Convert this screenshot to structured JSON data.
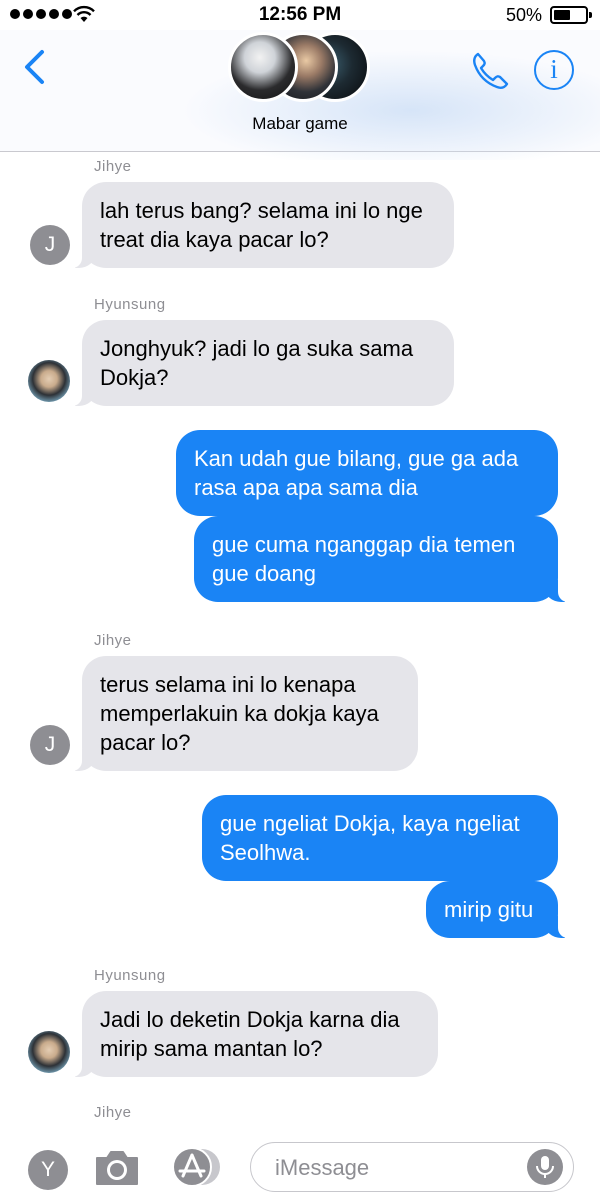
{
  "status_bar": {
    "time": "12:56 PM",
    "battery_percent": "50%",
    "signal_dots": 5
  },
  "header": {
    "title": "Mabar game",
    "back_icon": "chevron-left-icon",
    "call_icon": "phone-icon",
    "info_label": "i"
  },
  "messages": [
    {
      "type": "sender",
      "text": "Jihye"
    },
    {
      "type": "in",
      "text": "lah terus bang? selama ini lo nge treat dia kaya pacar lo?",
      "avatar": "J"
    },
    {
      "type": "sender",
      "text": "Hyunsung"
    },
    {
      "type": "in",
      "text": "Jonghyuk? jadi lo ga suka sama Dokja?",
      "avatar": "photo"
    },
    {
      "type": "out",
      "text": "Kan udah gue bilang, gue ga ada rasa apa apa sama dia"
    },
    {
      "type": "out",
      "text": "gue cuma nganggap dia temen gue doang"
    },
    {
      "type": "sender",
      "text": "Jihye"
    },
    {
      "type": "in",
      "text": "terus selama ini lo kenapa memperlakuin ka dokja kaya pacar lo?",
      "avatar": "J"
    },
    {
      "type": "out",
      "text": "gue ngeliat Dokja, kaya ngeliat Seolhwa."
    },
    {
      "type": "out",
      "text": "mirip gitu"
    },
    {
      "type": "sender",
      "text": "Hyunsung"
    },
    {
      "type": "in",
      "text": "Jadi lo deketin Dokja karna dia mirip sama mantan lo?",
      "avatar": "photo"
    },
    {
      "type": "sender",
      "text": "Jihye"
    }
  ],
  "input_bar": {
    "avatar_letter": "Y",
    "placeholder": "iMessage"
  },
  "colors": {
    "accent": "#1a84f5",
    "incoming_bubble": "#e5e5ea",
    "sender_text": "#8e8e93"
  }
}
